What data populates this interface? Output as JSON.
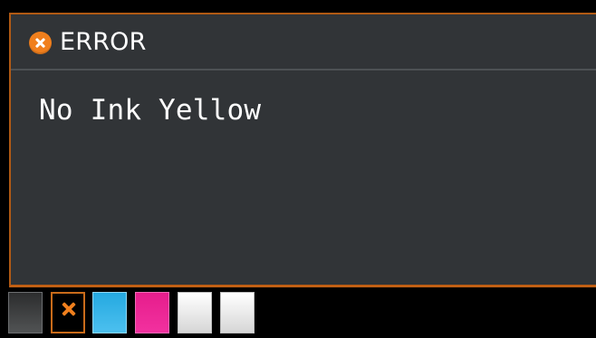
{
  "screen": {
    "title": "ERROR",
    "message": "No Ink Yellow",
    "icon": "error-icon"
  },
  "ink_levels": [
    {
      "name": "black",
      "color": "#3a3b3c"
    },
    {
      "name": "yellow-error",
      "color": "#f07f1d"
    },
    {
      "name": "cyan",
      "color": "#2ab2e8"
    },
    {
      "name": "magenta",
      "color": "#ed2897"
    },
    {
      "name": "white",
      "color": "#f2f2f2"
    },
    {
      "name": "white",
      "color": "#f2f2f2"
    }
  ],
  "colors": {
    "panel_background": "#313437",
    "accent_orange": "#f07f1d",
    "border_orange": "#b15a14"
  }
}
